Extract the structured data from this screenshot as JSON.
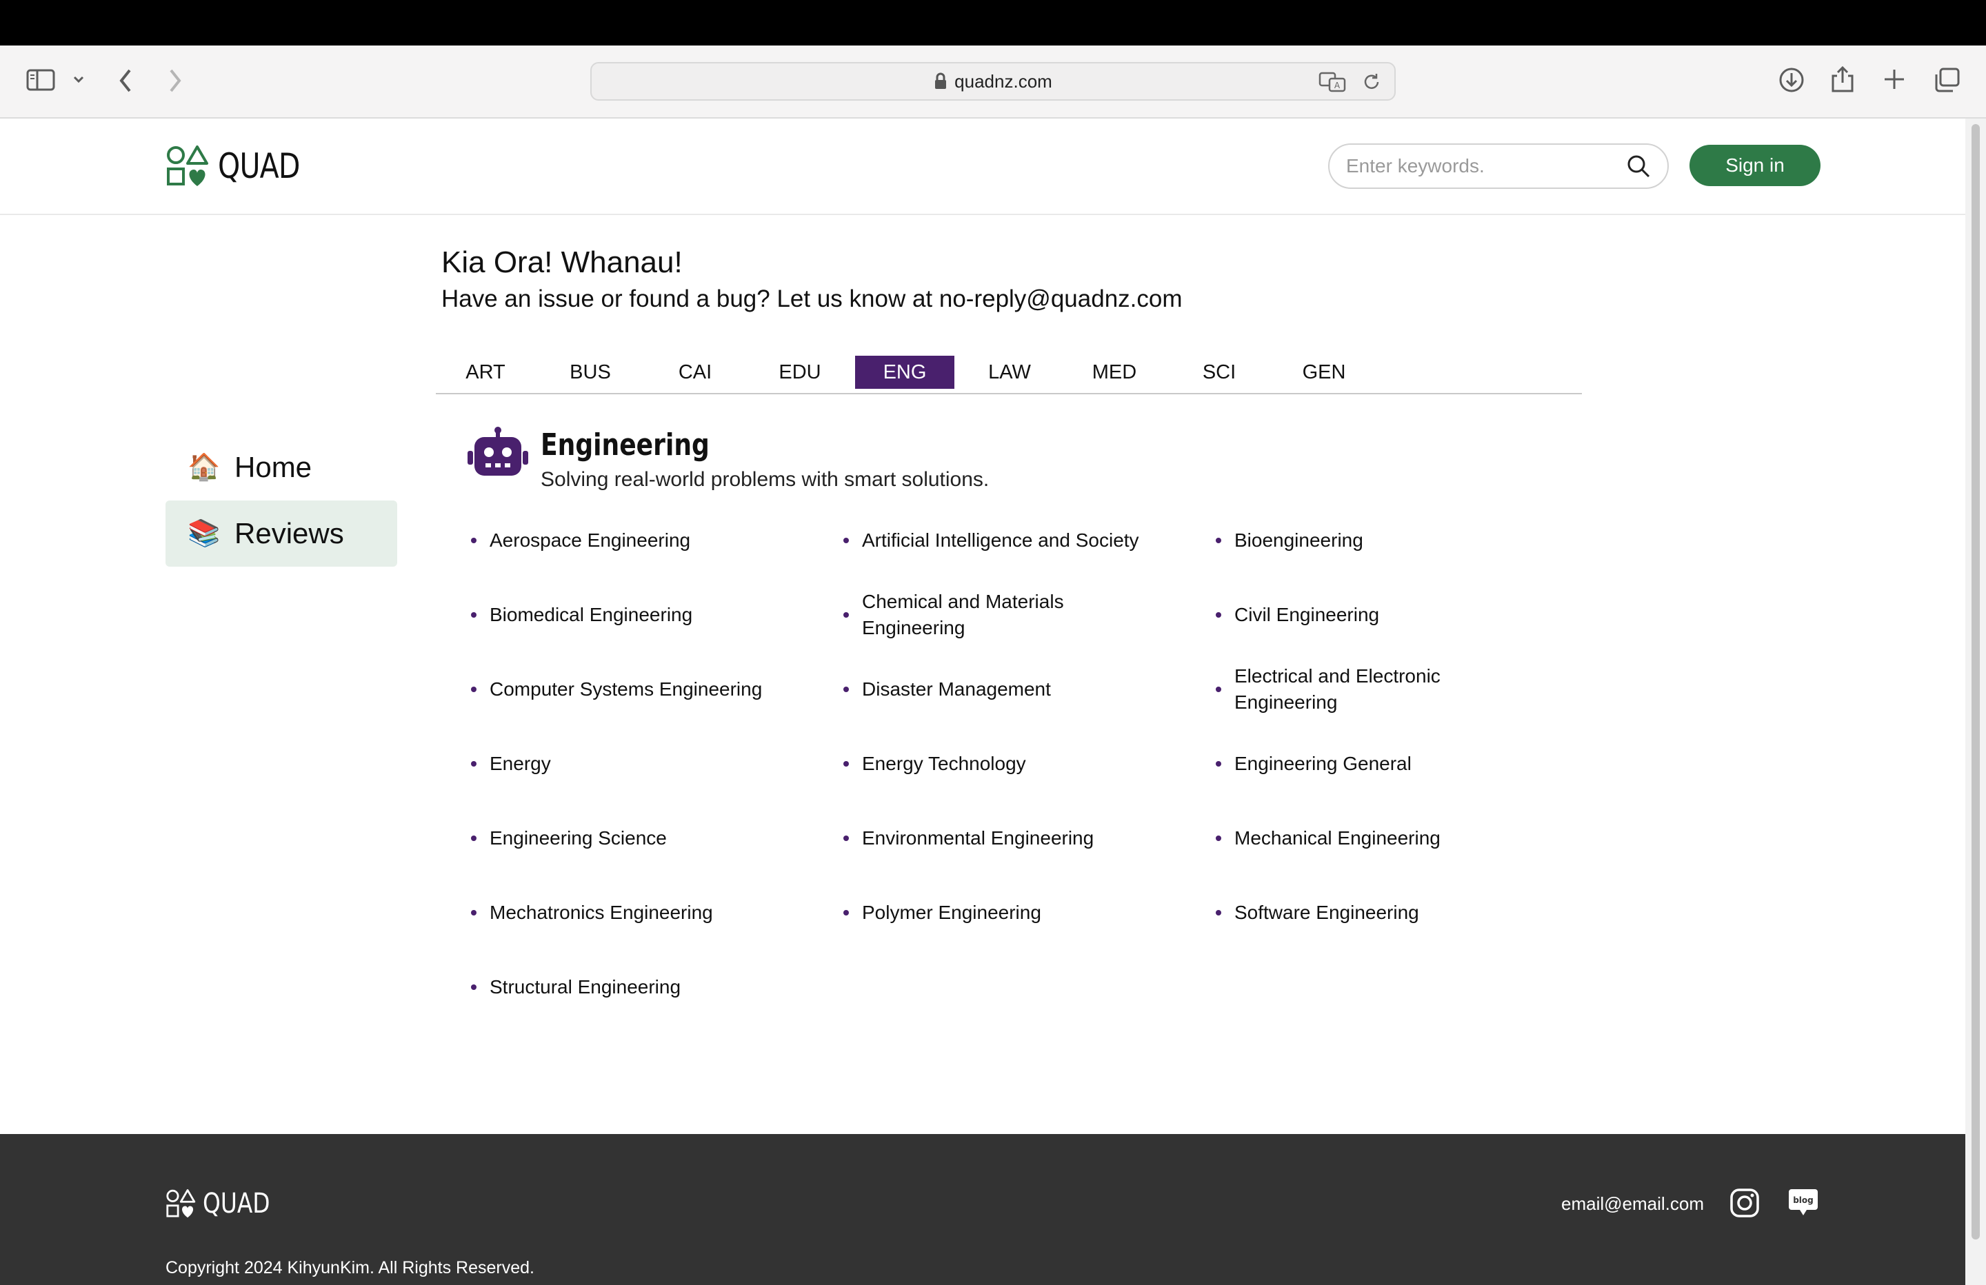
{
  "browser": {
    "url": "quadnz.com"
  },
  "header": {
    "logo_text": "QUAD",
    "search_placeholder": "Enter keywords.",
    "signin_label": "Sign in",
    "accent_color": "#2e7a47"
  },
  "sidebar": {
    "items": [
      {
        "icon": "🏠",
        "label": "Home",
        "active": false
      },
      {
        "icon": "📚",
        "label": "Reviews",
        "active": true
      }
    ]
  },
  "main": {
    "greeting": "Kia Ora! Whanau!",
    "notice": "Have an issue or found a bug? Let us know at no-reply@quadnz.com",
    "tabs": [
      "ART",
      "BUS",
      "CAI",
      "EDU",
      "ENG",
      "LAW",
      "MED",
      "SCI",
      "GEN"
    ],
    "active_tab": "ENG",
    "tab_accent_color": "#49206d",
    "category": {
      "title": "Engineering",
      "subtitle": "Solving real-world problems with smart solutions.",
      "icon": "robot-icon",
      "subjects": [
        "Aerospace Engineering",
        "Artificial Intelligence and Society",
        "Bioengineering",
        "Biomedical Engineering",
        "Chemical and Materials Engineering",
        "Civil Engineering",
        "Computer Systems Engineering",
        "Disaster Management",
        "Electrical and Electronic Engineering",
        "Energy",
        "Energy Technology",
        "Engineering General",
        "Engineering Science",
        "Environmental Engineering",
        "Mechanical Engineering",
        "Mechatronics Engineering",
        "Polymer Engineering",
        "Software Engineering",
        "Structural Engineering"
      ]
    }
  },
  "footer": {
    "logo_text": "QUAD",
    "email": "email@email.com",
    "copyright": "Copyright 2024 KihyunKim. All Rights Reserved.",
    "blog_label": "blog"
  }
}
